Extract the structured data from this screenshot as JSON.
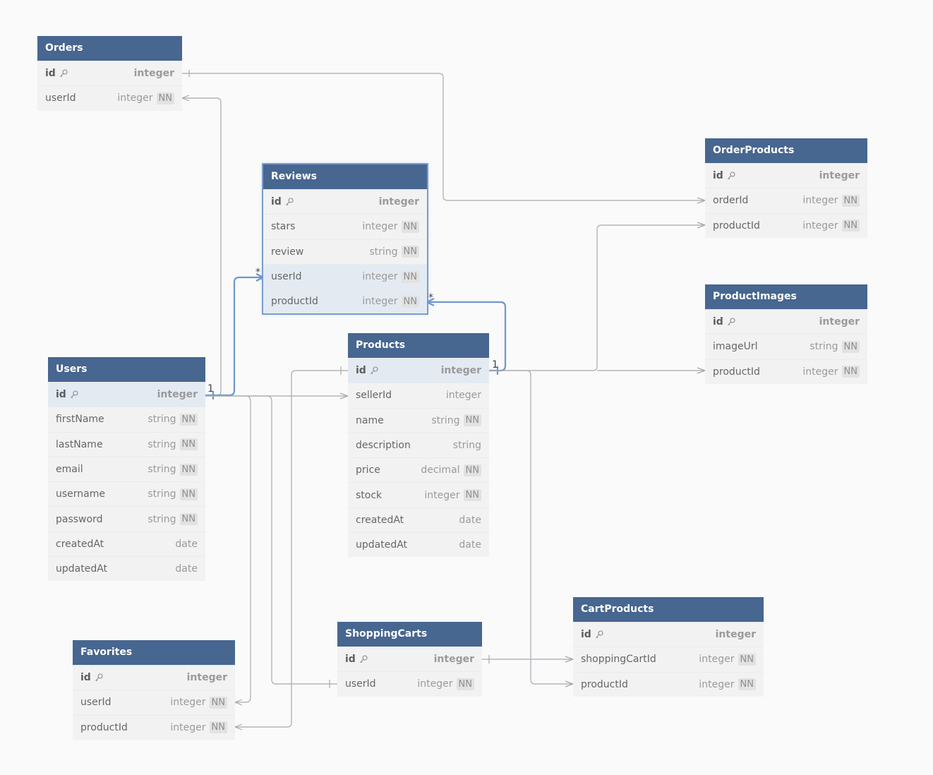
{
  "diagram": {
    "tables": [
      {
        "id": "orders",
        "name": "Orders",
        "fields": [
          {
            "name": "id",
            "type": "integer",
            "pk": true,
            "nn": false
          },
          {
            "name": "userId",
            "type": "integer",
            "pk": false,
            "nn": true
          }
        ]
      },
      {
        "id": "reviews",
        "name": "Reviews",
        "selected": true,
        "fields": [
          {
            "name": "id",
            "type": "integer",
            "pk": true,
            "nn": false
          },
          {
            "name": "stars",
            "type": "integer",
            "pk": false,
            "nn": true
          },
          {
            "name": "review",
            "type": "string",
            "pk": false,
            "nn": true
          },
          {
            "name": "userId",
            "type": "integer",
            "pk": false,
            "nn": true,
            "highlight": true
          },
          {
            "name": "productId",
            "type": "integer",
            "pk": false,
            "nn": true,
            "highlight": true
          }
        ]
      },
      {
        "id": "orderproducts",
        "name": "OrderProducts",
        "fields": [
          {
            "name": "id",
            "type": "integer",
            "pk": true,
            "nn": false
          },
          {
            "name": "orderId",
            "type": "integer",
            "pk": false,
            "nn": true
          },
          {
            "name": "productId",
            "type": "integer",
            "pk": false,
            "nn": true
          }
        ]
      },
      {
        "id": "productimages",
        "name": "ProductImages",
        "fields": [
          {
            "name": "id",
            "type": "integer",
            "pk": true,
            "nn": false
          },
          {
            "name": "imageUrl",
            "type": "string",
            "pk": false,
            "nn": true
          },
          {
            "name": "productId",
            "type": "integer",
            "pk": false,
            "nn": true
          }
        ]
      },
      {
        "id": "users",
        "name": "Users",
        "fields": [
          {
            "name": "id",
            "type": "integer",
            "pk": true,
            "nn": false,
            "highlight": true
          },
          {
            "name": "firstName",
            "type": "string",
            "pk": false,
            "nn": true
          },
          {
            "name": "lastName",
            "type": "string",
            "pk": false,
            "nn": true
          },
          {
            "name": "email",
            "type": "string",
            "pk": false,
            "nn": true
          },
          {
            "name": "username",
            "type": "string",
            "pk": false,
            "nn": true
          },
          {
            "name": "password",
            "type": "string",
            "pk": false,
            "nn": true
          },
          {
            "name": "createdAt",
            "type": "date",
            "pk": false,
            "nn": false
          },
          {
            "name": "updatedAt",
            "type": "date",
            "pk": false,
            "nn": false
          }
        ]
      },
      {
        "id": "products",
        "name": "Products",
        "fields": [
          {
            "name": "id",
            "type": "integer",
            "pk": true,
            "nn": false,
            "highlight": true
          },
          {
            "name": "sellerId",
            "type": "integer",
            "pk": false,
            "nn": false
          },
          {
            "name": "name",
            "type": "string",
            "pk": false,
            "nn": true
          },
          {
            "name": "description",
            "type": "string",
            "pk": false,
            "nn": false
          },
          {
            "name": "price",
            "type": "decimal",
            "pk": false,
            "nn": true
          },
          {
            "name": "stock",
            "type": "integer",
            "pk": false,
            "nn": true
          },
          {
            "name": "createdAt",
            "type": "date",
            "pk": false,
            "nn": false
          },
          {
            "name": "updatedAt",
            "type": "date",
            "pk": false,
            "nn": false
          }
        ]
      },
      {
        "id": "cartproducts",
        "name": "CartProducts",
        "fields": [
          {
            "name": "id",
            "type": "integer",
            "pk": true,
            "nn": false
          },
          {
            "name": "shoppingCartId",
            "type": "integer",
            "pk": false,
            "nn": true
          },
          {
            "name": "productId",
            "type": "integer",
            "pk": false,
            "nn": true
          }
        ]
      },
      {
        "id": "favorites",
        "name": "Favorites",
        "fields": [
          {
            "name": "id",
            "type": "integer",
            "pk": true,
            "nn": false
          },
          {
            "name": "userId",
            "type": "integer",
            "pk": false,
            "nn": true
          },
          {
            "name": "productId",
            "type": "integer",
            "pk": false,
            "nn": true
          }
        ]
      },
      {
        "id": "shoppingcarts",
        "name": "ShoppingCarts",
        "fields": [
          {
            "name": "id",
            "type": "integer",
            "pk": true,
            "nn": false
          },
          {
            "name": "userId",
            "type": "integer",
            "pk": false,
            "nn": true
          }
        ]
      }
    ],
    "nn_label": "NN",
    "key_icon": "key-icon",
    "relationships": [
      {
        "from": "Orders.id",
        "to": "OrderProducts.orderId",
        "cardinality": "one-to-many",
        "highlighted": false
      },
      {
        "from": "Users.id",
        "to": "Orders.userId",
        "cardinality": "one-to-many",
        "highlighted": false
      },
      {
        "from": "Users.id",
        "to": "Reviews.userId",
        "cardinality": "one-to-many",
        "highlighted": true,
        "labels": [
          "1",
          "*"
        ]
      },
      {
        "from": "Products.id",
        "to": "Reviews.productId",
        "cardinality": "one-to-many",
        "highlighted": true,
        "labels": [
          "1",
          "*"
        ]
      },
      {
        "from": "Users.id",
        "to": "Products.sellerId",
        "cardinality": "one-to-many",
        "highlighted": false
      },
      {
        "from": "Products.id",
        "to": "OrderProducts.productId",
        "cardinality": "one-to-many",
        "highlighted": false
      },
      {
        "from": "Products.id",
        "to": "ProductImages.productId",
        "cardinality": "one-to-many",
        "highlighted": false
      },
      {
        "from": "Products.id",
        "to": "CartProducts.productId",
        "cardinality": "one-to-many",
        "highlighted": false
      },
      {
        "from": "Products.id",
        "to": "Favorites.productId",
        "cardinality": "one-to-many",
        "highlighted": false
      },
      {
        "from": "Users.id",
        "to": "Favorites.userId",
        "cardinality": "one-to-many",
        "highlighted": false
      },
      {
        "from": "Users.id",
        "to": "ShoppingCarts.userId",
        "cardinality": "one-to-one",
        "highlighted": false
      },
      {
        "from": "ShoppingCarts.id",
        "to": "CartProducts.shoppingCartId",
        "cardinality": "one-to-many",
        "highlighted": false
      }
    ],
    "colors": {
      "header": "#476690",
      "edge": "#a8a8b0",
      "edge_highlight": "#6f96cc",
      "row_highlight": "#e3eaf2"
    }
  }
}
